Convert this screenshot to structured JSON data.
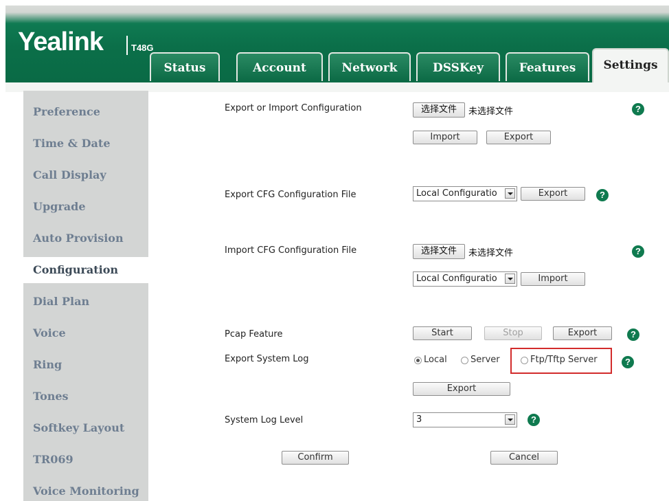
{
  "brand": {
    "logo": "Yealink",
    "model": "T48G"
  },
  "tabs": [
    "Status",
    "Account",
    "Network",
    "DSSKey",
    "Features",
    "Settings"
  ],
  "active_tab": "Settings",
  "sidebar": {
    "items": [
      "Preference",
      "Time & Date",
      "Call Display",
      "Upgrade",
      "Auto Provision",
      "Configuration",
      "Dial Plan",
      "Voice",
      "Ring",
      "Tones",
      "Softkey Layout",
      "TR069",
      "Voice Monitoring"
    ],
    "active": "Configuration"
  },
  "config": {
    "export_import": {
      "label": "Export or Import Configuration",
      "choose_file": "选择文件",
      "no_file": "未选择文件",
      "import": "Import",
      "export": "Export"
    },
    "export_cfg": {
      "label": "Export CFG Configuration File",
      "select": "Local Configuratio",
      "export": "Export"
    },
    "import_cfg": {
      "label": "Import CFG Configuration File",
      "choose_file": "选择文件",
      "no_file": "未选择文件",
      "select": "Local Configuratio",
      "import": "Import"
    },
    "pcap": {
      "label": "Pcap Feature",
      "start": "Start",
      "stop": "Stop",
      "export": "Export"
    },
    "system_log": {
      "label": "Export System Log",
      "options": [
        "Local",
        "Server",
        "Ftp/Tftp Server"
      ],
      "selected": "Local",
      "export": "Export"
    },
    "log_level": {
      "label": "System Log Level",
      "value": "3"
    },
    "confirm": "Confirm",
    "cancel": "Cancel"
  },
  "help_icon": "?",
  "colors": {
    "header_green": "#0b6f49",
    "highlight": "#d22b2b",
    "help_icon": "#0f7a4f"
  }
}
